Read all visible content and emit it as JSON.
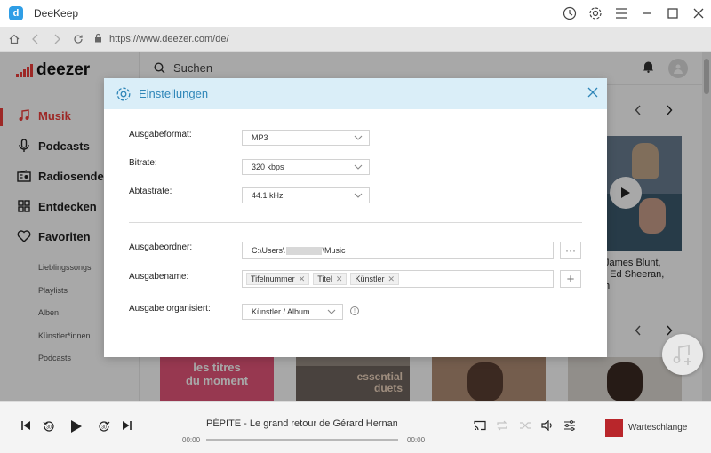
{
  "window": {
    "title": "DeeKeep"
  },
  "browser": {
    "url": "https://www.deezer.com/de/"
  },
  "deezer": {
    "brand": "deezer",
    "search_placeholder": "Suchen",
    "menu": [
      {
        "label": "Musik",
        "icon": "music-note-icon",
        "active": true
      },
      {
        "label": "Podcasts",
        "icon": "microphone-icon"
      },
      {
        "label": "Radiosender",
        "icon": "radio-icon"
      },
      {
        "label": "Entdecken",
        "icon": "grid-icon"
      },
      {
        "label": "Favoriten",
        "icon": "heart-icon"
      }
    ],
    "submenu": [
      "Lieblingssongs",
      "Playlists",
      "Alben",
      "Künstler*innen",
      "Podcasts"
    ],
    "content": {
      "artist_text_line1": "James Blunt,",
      "artist_text_line2": ", Ed Sheeran,",
      "artist_text_line3": "h",
      "card1_line1": "les titres",
      "card1_line2": "du moment",
      "card2_line1": "essential",
      "card2_line2": "duets"
    }
  },
  "player": {
    "track": "PÉPITE - Le grand retour de Gérard Hernandez",
    "time_elapsed": "00:00",
    "time_total": "00:00",
    "queue_label": "Warteschlange",
    "progress": 0
  },
  "settings": {
    "title": "Einstellungen",
    "format_label": "Ausgabeformat:",
    "format_value": "MP3",
    "bitrate_label": "Bitrate:",
    "bitrate_value": "320 kbps",
    "samplerate_label": "Abtastrate:",
    "samplerate_value": "44.1 kHz",
    "folder_label": "Ausgabeordner:",
    "folder_prefix": "C:\\Users\\",
    "folder_suffix": "\\Music",
    "folder_button": "···",
    "name_label": "Ausgabename:",
    "name_tags": [
      "Tifelnummer",
      "Titel",
      "Künstler"
    ],
    "name_add": "+",
    "organize_label": "Ausgabe organisiert:",
    "organize_value": "Künstler / Album",
    "info_glyph": "!"
  },
  "colors": {
    "accent": "#ef3e3a",
    "dialog_header": "#daeef8",
    "dialog_title": "#2f86b8"
  }
}
